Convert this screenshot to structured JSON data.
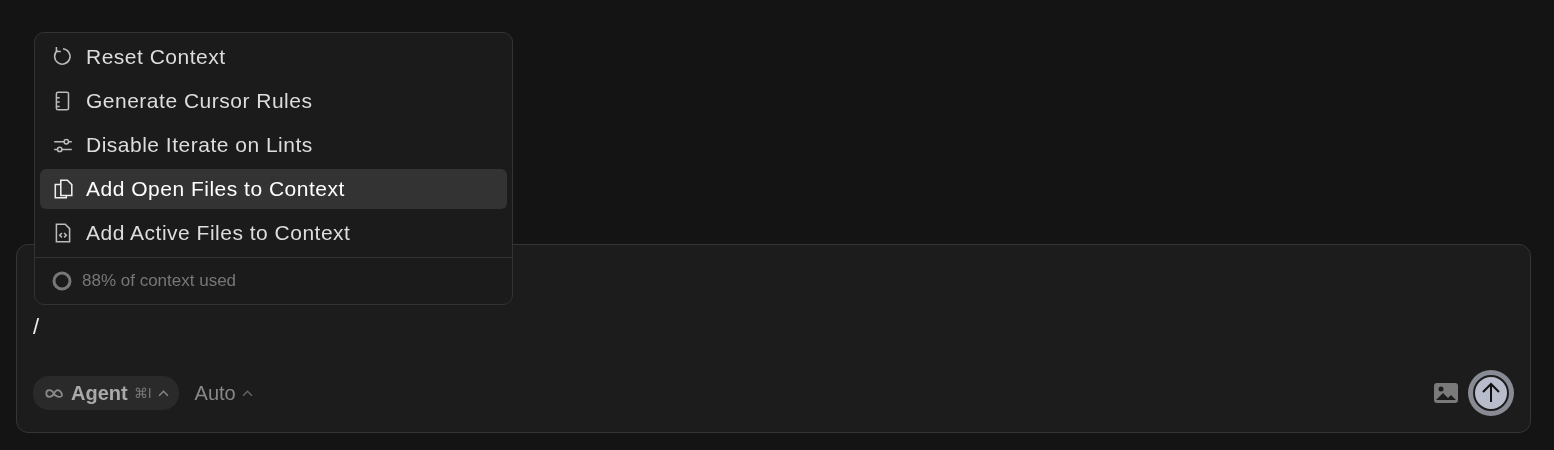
{
  "menu": {
    "items": [
      {
        "label": "Reset Context",
        "selected": false
      },
      {
        "label": "Generate Cursor Rules",
        "selected": false
      },
      {
        "label": "Disable Iterate on Lints",
        "selected": false
      },
      {
        "label": "Add Open Files to Context",
        "selected": true
      },
      {
        "label": "Add Active Files to Context",
        "selected": false
      }
    ],
    "footer": "88% of context used"
  },
  "composer": {
    "value": "/",
    "mode": {
      "label": "Agent",
      "shortcut": "⌘I"
    },
    "model": "Auto"
  }
}
